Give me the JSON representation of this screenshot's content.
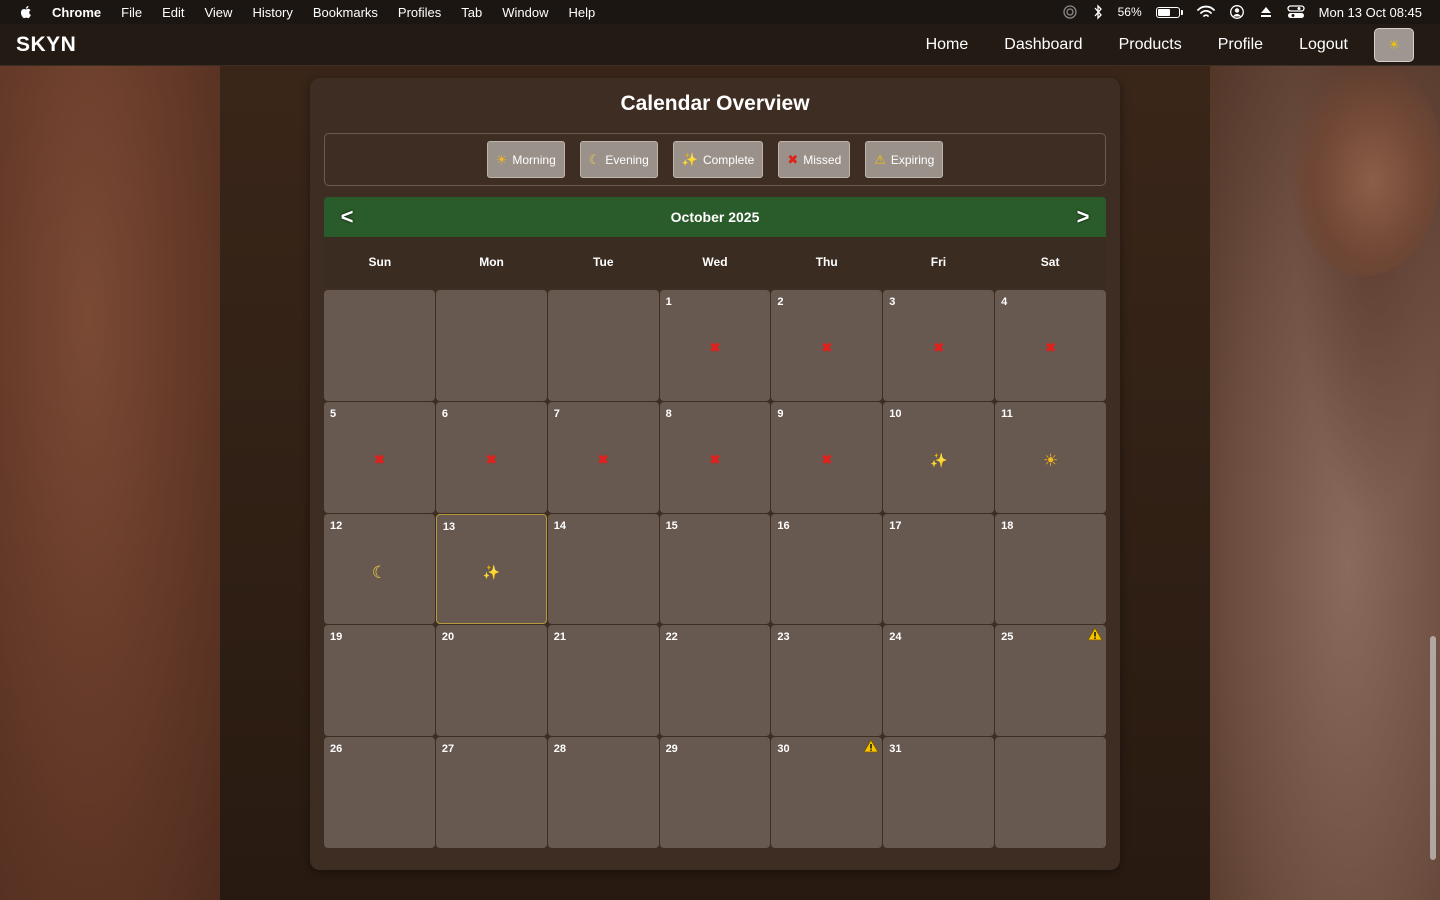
{
  "menubar": {
    "items": [
      "Chrome",
      "File",
      "Edit",
      "View",
      "History",
      "Bookmarks",
      "Profiles",
      "Tab",
      "Window",
      "Help"
    ],
    "battery": "56%",
    "datetime": "Mon 13 Oct  08:45"
  },
  "navbar": {
    "brand": "SKYN",
    "links": [
      "Home",
      "Dashboard",
      "Products",
      "Profile",
      "Logout"
    ],
    "theme_icon": "☀"
  },
  "calendar": {
    "title": "Calendar Overview",
    "legend": [
      {
        "label": "Morning",
        "icon": "☀",
        "icon_name": "sun-icon",
        "color": "#f3b81c"
      },
      {
        "label": "Evening",
        "icon": "☾",
        "icon_name": "moon-icon",
        "color": "#f2cf47"
      },
      {
        "label": "Complete",
        "icon": "✨",
        "icon_name": "sparkles-icon",
        "color": "#f5d94a"
      },
      {
        "label": "Missed",
        "icon": "✖",
        "icon_name": "cross-icon",
        "color": "#e0201a"
      },
      {
        "label": "Expiring",
        "icon": "⚠",
        "icon_name": "warning-icon",
        "color": "#f5c400"
      }
    ],
    "month_label": "October 2025",
    "prev_label": "<",
    "next_label": ">",
    "weekdays": [
      "Sun",
      "Mon",
      "Tue",
      "Wed",
      "Thu",
      "Fri",
      "Sat"
    ],
    "today": 13,
    "cells": [
      {
        "day": ""
      },
      {
        "day": ""
      },
      {
        "day": ""
      },
      {
        "day": "1",
        "mark": "missed"
      },
      {
        "day": "2",
        "mark": "missed"
      },
      {
        "day": "3",
        "mark": "missed"
      },
      {
        "day": "4",
        "mark": "missed"
      },
      {
        "day": "5",
        "mark": "missed"
      },
      {
        "day": "6",
        "mark": "missed"
      },
      {
        "day": "7",
        "mark": "missed"
      },
      {
        "day": "8",
        "mark": "missed"
      },
      {
        "day": "9",
        "mark": "missed"
      },
      {
        "day": "10",
        "mark": "complete"
      },
      {
        "day": "11",
        "mark": "morning"
      },
      {
        "day": "12",
        "mark": "evening"
      },
      {
        "day": "13",
        "mark": "complete"
      },
      {
        "day": "14"
      },
      {
        "day": "15"
      },
      {
        "day": "16"
      },
      {
        "day": "17"
      },
      {
        "day": "18"
      },
      {
        "day": "19"
      },
      {
        "day": "20"
      },
      {
        "day": "21"
      },
      {
        "day": "22"
      },
      {
        "day": "23"
      },
      {
        "day": "24"
      },
      {
        "day": "25",
        "expiring": true
      },
      {
        "day": "26"
      },
      {
        "day": "27"
      },
      {
        "day": "28"
      },
      {
        "day": "29"
      },
      {
        "day": "30",
        "expiring": true
      },
      {
        "day": "31"
      },
      {
        "day": ""
      }
    ]
  }
}
